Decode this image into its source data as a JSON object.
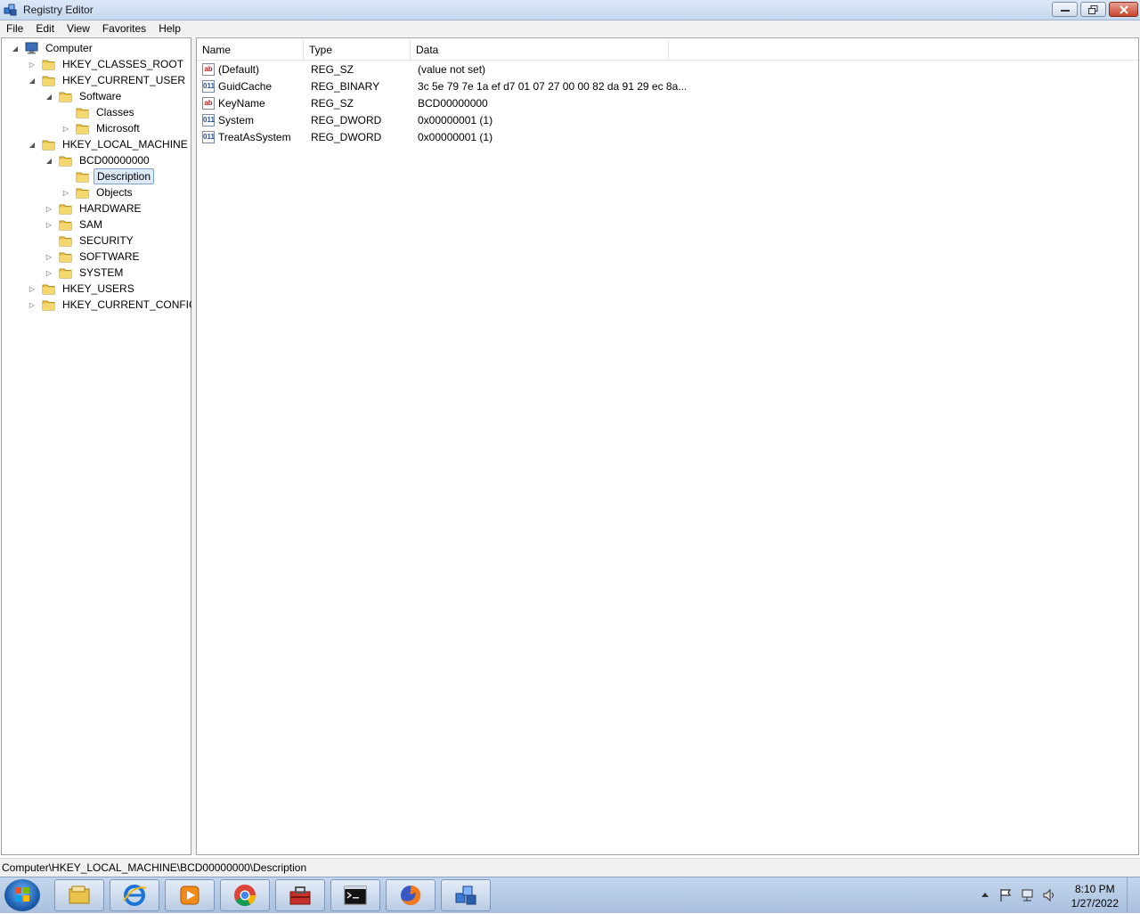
{
  "window": {
    "title": "Registry Editor"
  },
  "menu": [
    "File",
    "Edit",
    "View",
    "Favorites",
    "Help"
  ],
  "tree": [
    {
      "label": "Computer",
      "level": 0,
      "expander": "open",
      "icon": "computer-icon"
    },
    {
      "label": "HKEY_CLASSES_ROOT",
      "level": 1,
      "expander": "closed",
      "icon": "folder-icon"
    },
    {
      "label": "HKEY_CURRENT_USER",
      "level": 1,
      "expander": "open",
      "icon": "folder-icon"
    },
    {
      "label": "Software",
      "level": 2,
      "expander": "open",
      "icon": "folder-icon"
    },
    {
      "label": "Classes",
      "level": 3,
      "expander": "none",
      "icon": "folder-icon"
    },
    {
      "label": "Microsoft",
      "level": 3,
      "expander": "closed",
      "icon": "folder-icon"
    },
    {
      "label": "HKEY_LOCAL_MACHINE",
      "level": 1,
      "expander": "open",
      "icon": "folder-icon"
    },
    {
      "label": "BCD00000000",
      "level": 2,
      "expander": "open",
      "icon": "folder-icon"
    },
    {
      "label": "Description",
      "level": 3,
      "expander": "none",
      "icon": "folder-icon",
      "selected": true
    },
    {
      "label": "Objects",
      "level": 3,
      "expander": "closed",
      "icon": "folder-icon"
    },
    {
      "label": "HARDWARE",
      "level": 2,
      "expander": "closed",
      "icon": "folder-icon"
    },
    {
      "label": "SAM",
      "level": 2,
      "expander": "closed",
      "icon": "folder-icon"
    },
    {
      "label": "SECURITY",
      "level": 2,
      "expander": "none",
      "icon": "folder-icon"
    },
    {
      "label": "SOFTWARE",
      "level": 2,
      "expander": "closed",
      "icon": "folder-icon"
    },
    {
      "label": "SYSTEM",
      "level": 2,
      "expander": "closed",
      "icon": "folder-icon"
    },
    {
      "label": "HKEY_USERS",
      "level": 1,
      "expander": "closed",
      "icon": "folder-icon"
    },
    {
      "label": "HKEY_CURRENT_CONFIG",
      "level": 1,
      "expander": "closed",
      "icon": "folder-icon"
    }
  ],
  "columns": [
    "Name",
    "Type",
    "Data"
  ],
  "values": [
    {
      "name": "(Default)",
      "type": "REG_SZ",
      "data": "(value not set)",
      "icon": "string"
    },
    {
      "name": "GuidCache",
      "type": "REG_BINARY",
      "data": "3c 5e 79 7e 1a ef d7 01 07 27 00 00 82 da 91 29 ec 8a...",
      "icon": "binary"
    },
    {
      "name": "KeyName",
      "type": "REG_SZ",
      "data": "BCD00000000",
      "icon": "string"
    },
    {
      "name": "System",
      "type": "REG_DWORD",
      "data": "0x00000001 (1)",
      "icon": "binary"
    },
    {
      "name": "TreatAsSystem",
      "type": "REG_DWORD",
      "data": "0x00000001 (1)",
      "icon": "binary"
    }
  ],
  "icon_glyphs": {
    "string": "ab",
    "binary": "011"
  },
  "status": {
    "path": "Computer\\HKEY_LOCAL_MACHINE\\BCD00000000\\Description"
  },
  "taskbar": {
    "apps": [
      {
        "name": "explorer-icon"
      },
      {
        "name": "internet-explorer-icon"
      },
      {
        "name": "media-player-icon"
      },
      {
        "name": "chrome-icon"
      },
      {
        "name": "toolbox-icon"
      },
      {
        "name": "command-prompt-icon"
      },
      {
        "name": "firefox-icon"
      },
      {
        "name": "registry-editor-icon"
      }
    ],
    "clock": {
      "time": "8:10 PM",
      "date": "1/27/2022"
    }
  },
  "colors": {
    "selection": "#dceaf8",
    "selection_border": "#7da2ce",
    "taskbar": "#a9c0de"
  }
}
